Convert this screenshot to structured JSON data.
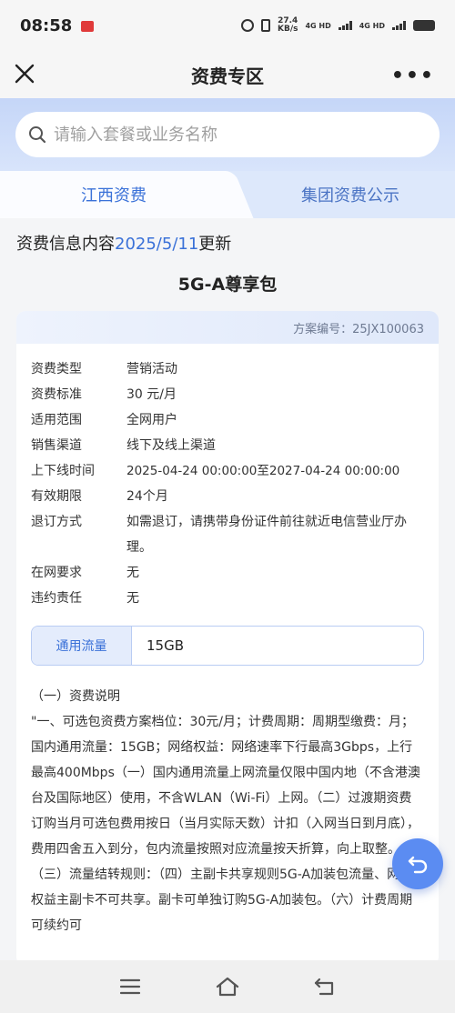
{
  "status_bar": {
    "time": "08:58",
    "speed_value": "27.4",
    "speed_unit": "KB/s",
    "network_1": "4G HD",
    "network_2": "4G HD"
  },
  "nav": {
    "title": "资费专区"
  },
  "search": {
    "placeholder": "请输入套餐或业务名称"
  },
  "tabs": [
    {
      "label": "江西资费",
      "active": true
    },
    {
      "label": "集团资费公示",
      "active": false
    }
  ],
  "update": {
    "prefix": "资费信息内容",
    "date": "2025/5/11",
    "suffix": "更新"
  },
  "package": {
    "title": "5G-A尊享包",
    "plan_no": "方案编号：25JX100063",
    "details": [
      {
        "key": "资费类型",
        "value": "营销活动"
      },
      {
        "key": "资费标准",
        "value": "30 元/月"
      },
      {
        "key": "适用范围",
        "value": "全网用户"
      },
      {
        "key": "销售渠道",
        "value": "线下及线上渠道"
      },
      {
        "key": "上下线时间",
        "value": "2025-04-24 00:00:00至2027-04-24 00:00:00"
      },
      {
        "key": "有效期限",
        "value": "24个月"
      },
      {
        "key": "退订方式",
        "value": "如需退订，请携带身份证件前往就近电信营业厅办理。"
      },
      {
        "key": "在网要求",
        "value": "无"
      },
      {
        "key": "违约责任",
        "value": "无"
      }
    ],
    "traffic_label": "通用流量",
    "traffic_value": "15GB",
    "desc_heading": "（一）资费说明",
    "desc_body": "\"一、可选包资费方案档位：30元/月；计费周期：周期型缴费：月；国内通用流量：15GB；网络权益：网络速率下行最高3Gbps，上行最高400Mbps（一）国内通用流量上网流量仅限中国内地（不含港澳台及国际地区）使用，不含WLAN（Wi-Fi）上网。（二）过渡期资费订购当月可选包费用按日（当月实际天数）计扣（入网当日到月底），费用四舍五入到分，包内流量按照对应流量按天折算，向上取整。（三）流量结转规则：（四）主副卡共享规则5G-A加装包流量、网络权益主副卡不可共享。副卡可单独订购5G-A加装包。（六）计费周期可续约可"
  },
  "colors": {
    "accent": "#3a71d8",
    "search_band": "#c5d6f8",
    "fab": "#5b8cf2"
  }
}
